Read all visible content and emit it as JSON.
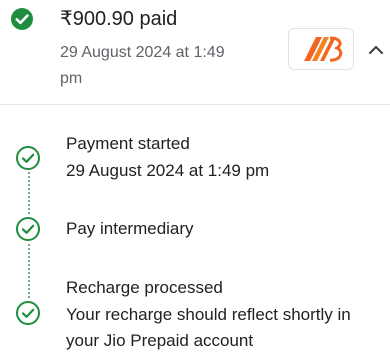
{
  "payment": {
    "amount_status": "₹900.90 paid",
    "datetime": "29 August 2024 at 1:49 pm",
    "status_icon": "check-circle-filled-icon",
    "bank_logo": "bank-of-baroda-logo",
    "expand_icon": "chevron-up-icon"
  },
  "colors": {
    "success": "#1e8e3e",
    "timeline": "#7ba88a",
    "logo_orange": "#f26522"
  },
  "timeline": {
    "steps": [
      {
        "title": "Payment started",
        "subtitle": "29 August 2024 at 1:49 pm",
        "icon": "check-circle-outline-icon"
      },
      {
        "title": "Pay intermediary",
        "subtitle": "",
        "icon": "check-circle-outline-icon"
      },
      {
        "title": "Recharge processed",
        "subtitle": "Your recharge should reflect shortly in your Jio Prepaid account",
        "icon": "check-circle-outline-icon"
      }
    ]
  }
}
